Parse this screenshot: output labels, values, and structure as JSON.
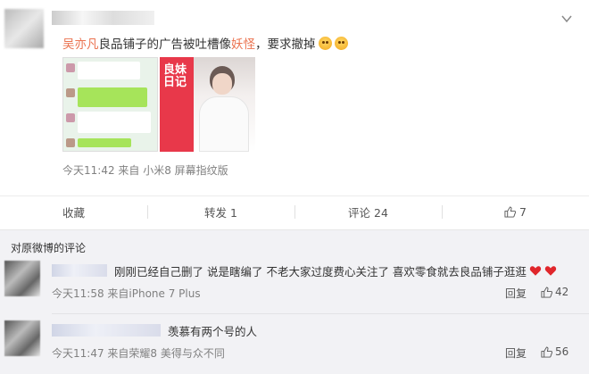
{
  "post": {
    "text_hl1": "吴亦凡",
    "text_mid": "良品铺子的广告被吐槽像",
    "text_hl2": "妖怪",
    "text_end": "，要求撤掉",
    "emoji1": "doge-emoji",
    "emoji2": "doge-emoji",
    "image2_title": "良妹日记",
    "meta": "今天11:42 来自 小米8 屏幕指纹版"
  },
  "actions": {
    "favorite_label": "收藏",
    "repost_label": "转发 1",
    "comment_label": "评论 24",
    "like_count": "7"
  },
  "comments_section": {
    "title": "对原微博的评论",
    "comments": [
      {
        "text": "刚刚已经自己删了 说是瞎编了 不老大家过度费心关注了 喜欢零食就去良品铺子逛逛",
        "meta": "今天11:58 来自iPhone 7 Plus",
        "reply_label": "回复",
        "like_count": "42"
      },
      {
        "text": "羡慕有两个号的人",
        "meta": "今天11:47 来自荣耀8 美得与众不同",
        "reply_label": "回复",
        "like_count": "56"
      }
    ]
  },
  "colors": {
    "highlight": "#eb7350",
    "heart": "#e0262b",
    "image_red": "#e8384a"
  }
}
